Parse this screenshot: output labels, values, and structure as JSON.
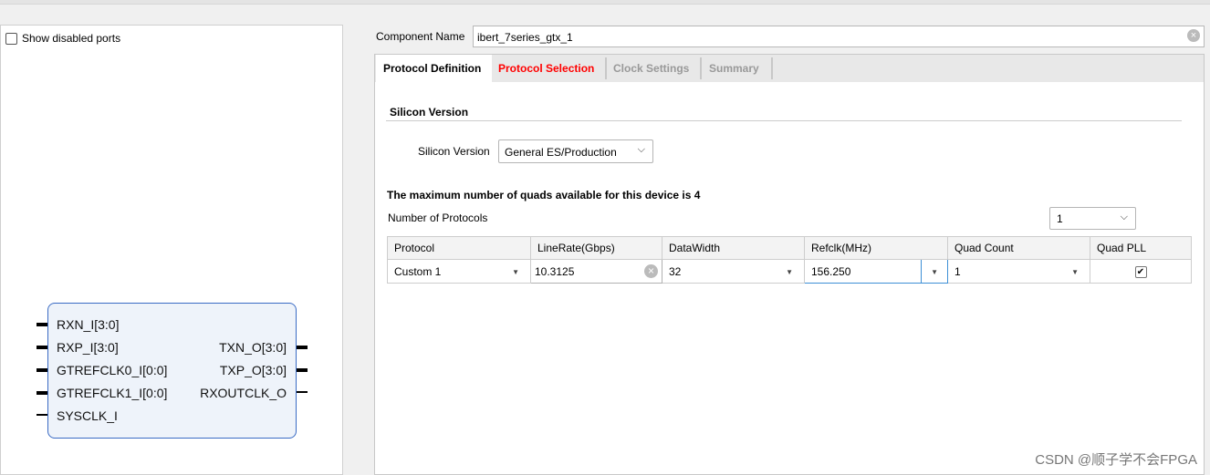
{
  "left_panel": {
    "show_disabled_ports_label": "Show disabled ports",
    "show_disabled_ports_checked": false
  },
  "block": {
    "inputs": [
      "RXN_I[3:0]",
      "RXP_I[3:0]",
      "GTREFCLK0_I[0:0]",
      "GTREFCLK1_I[0:0]",
      "SYSCLK_I"
    ],
    "outputs": [
      "TXN_O[3:0]",
      "TXP_O[3:0]",
      "RXOUTCLK_O"
    ]
  },
  "component": {
    "label": "Component Name",
    "value": "ibert_7series_gtx_1"
  },
  "tabs": [
    {
      "label": "Protocol Definition",
      "state": "active"
    },
    {
      "label": "Protocol Selection",
      "state": "error",
      "color": "#ff0000"
    },
    {
      "label": "Clock Settings",
      "state": "disabled"
    },
    {
      "label": "Summary",
      "state": "disabled"
    }
  ],
  "silicon": {
    "section": "Silicon Version",
    "label": "Silicon Version",
    "value": "General ES/Production"
  },
  "quads_note": "The maximum number of quads available for this device is 4",
  "num_protocols": {
    "label": "Number of Protocols",
    "value": "1"
  },
  "table": {
    "headers": [
      "Protocol",
      "LineRate(Gbps)",
      "DataWidth",
      "Refclk(MHz)",
      "Quad Count",
      "Quad PLL"
    ],
    "rows": [
      {
        "protocol": "Custom 1",
        "linerate": "10.3125",
        "datawidth": "32",
        "refclk": "156.250",
        "quadcount": "1",
        "quadpll": true
      }
    ]
  },
  "watermark": "CSDN @顺子学不会FPGA"
}
